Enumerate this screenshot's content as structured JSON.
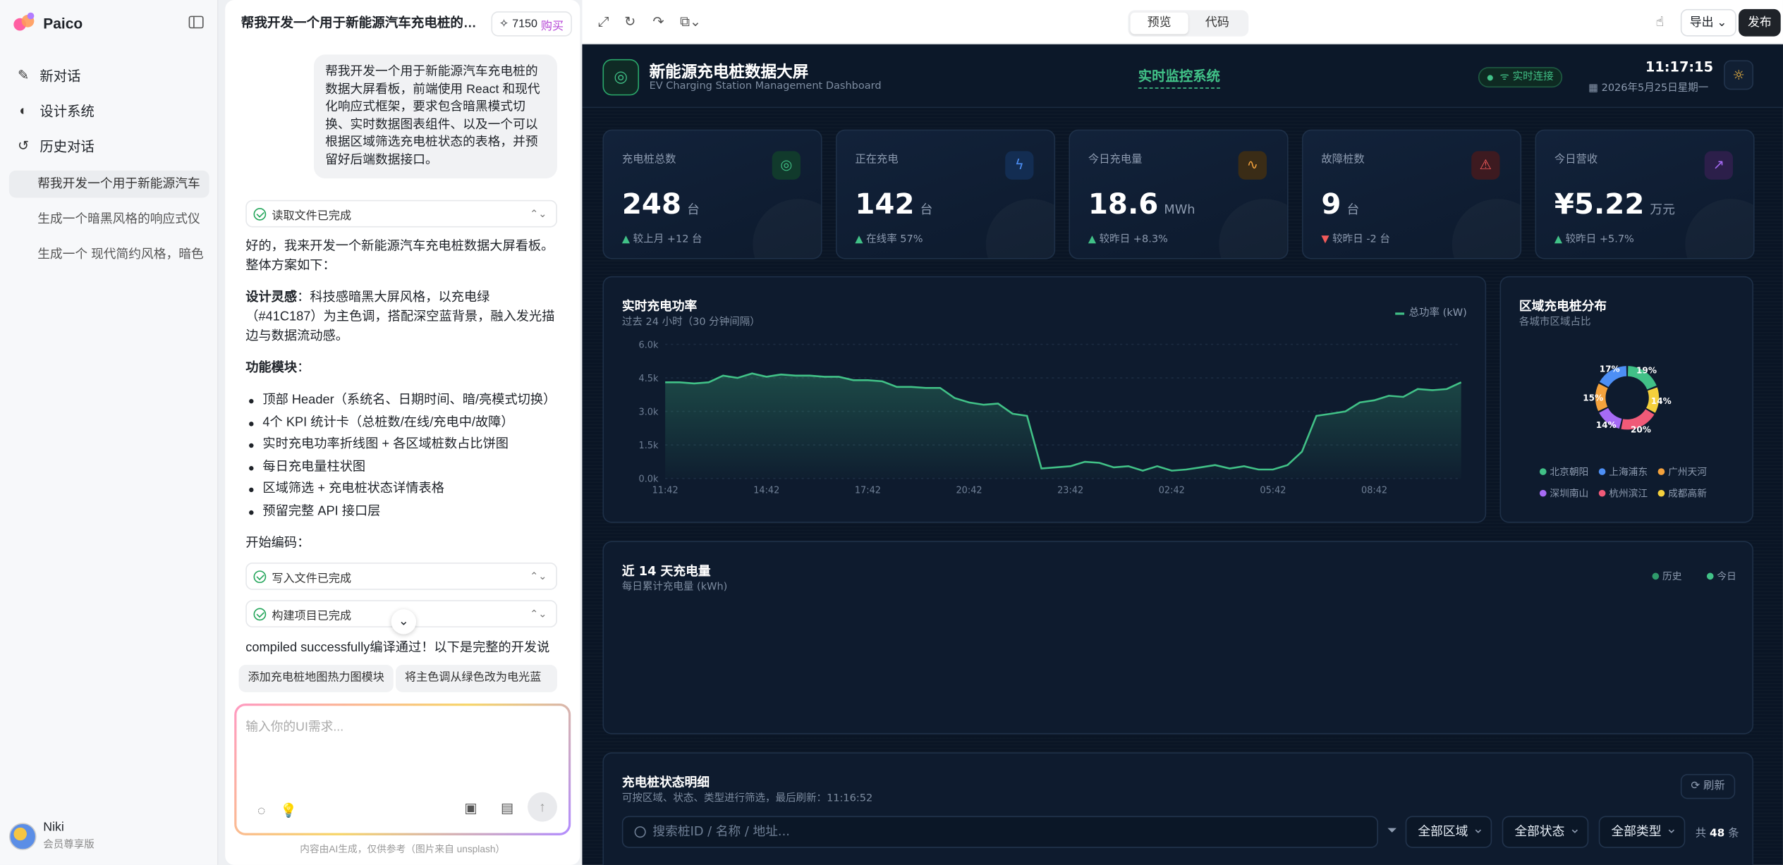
{
  "app": {
    "name": "Paico"
  },
  "sidebar": {
    "nav": [
      {
        "label": "新对话",
        "icon": "edit-icon"
      },
      {
        "label": "设计系统",
        "icon": "palette-icon"
      },
      {
        "label": "历史对话",
        "icon": "history-icon"
      }
    ],
    "history": [
      "帮我开发一个用于新能源汽车",
      "生成一个暗黑风格的响应式仪",
      "生成一个 现代简约风格，暗色"
    ],
    "user": {
      "name": "Niki",
      "role": "会员尊享版"
    }
  },
  "chat": {
    "title": "帮我开发一个用于新能源汽车充电桩的数据...",
    "credits": "7150",
    "buy": "购买",
    "user_message": "帮我开发一个用于新能源汽车充电桩的数据大屏看板，前端使用 React 和现代化响应式框架，要求包含暗黑模式切换、实时数据图表组件、以及一个可以根据区域筛选充电桩状态的表格，并预留好后端数据接口。",
    "status_read": "读取文件已完成",
    "intro": "好的，我来开发一个新能源汽车充电桩数据大屏看板。整体方案如下：",
    "design_label": "设计灵感",
    "design_text": "：科技感暗黑大屏风格，以充电绿（#41C187）为主色调，搭配深空蓝背景，融入发光描边与数据流动感。",
    "modules_label": "功能模块",
    "modules_colon": "：",
    "bullets": [
      "顶部 Header（系统名、日期时间、暗/亮模式切换）",
      "4个 KPI 统计卡（总桩数/在线/充电中/故障）",
      "实时充电功率折线图 + 各区域桩数占比饼图",
      "每日充电量柱状图",
      "区域筛选 + 充电桩状态详情表格",
      "预留完整 API 接口层"
    ],
    "start": "开始编码：",
    "status_write": "写入文件已完成",
    "status_build": "构建项目已完成",
    "compiled": "compiled successfully编译通过！以下是完整的开发说",
    "suggestions": [
      "添加充电桩地图热力图模块",
      "将主色调从绿色改为电光蓝"
    ],
    "input_placeholder": "输入你的UI需求...",
    "footer": "内容由AI生成，仅供参考（图片来自 unsplash）"
  },
  "toolbar": {
    "tab_preview": "预览",
    "tab_code": "代码",
    "export": "导出",
    "publish": "发布"
  },
  "dashboard": {
    "title": "新能源充电桩数据大屏",
    "subtitle": "EV Charging Station Management Dashboard",
    "mid_title": "实时监控系统",
    "live": "实时连接",
    "time": "11:17:15",
    "date": "2026年5月25日星期一",
    "kpis": [
      {
        "label": "充电桩总数",
        "value": "248",
        "unit": "台",
        "arrow": "▲",
        "change": "较上月 +12 台",
        "icon": "target-icon",
        "color": "#41c187",
        "icbg": "#113a2c",
        "arrowColor": "#41c187"
      },
      {
        "label": "正在充电",
        "value": "142",
        "unit": "台",
        "arrow": "▲",
        "change": "在线率 57%",
        "icon": "lightning-icon",
        "color": "#4d8ff5",
        "icbg": "#132d52",
        "arrowColor": "#41c187"
      },
      {
        "label": "今日充电量",
        "value": "18.6",
        "unit": "MWh",
        "arrow": "▲",
        "change": "较昨日 +8.3%",
        "icon": "pulse-icon",
        "color": "#f4a23c",
        "icbg": "#3a2c16",
        "arrowColor": "#41c187"
      },
      {
        "label": "故障桩数",
        "value": "9",
        "unit": "台",
        "arrow": "▼",
        "change": "较昨日 -2 台",
        "icon": "warning-icon",
        "color": "#f05a5a",
        "icbg": "#3d1a20",
        "arrowColor": "#f05a5a"
      },
      {
        "label": "今日营收",
        "value": "¥5.22",
        "unit": "万元",
        "arrow": "▲",
        "change": "较昨日 +5.7%",
        "icon": "trend-up-icon",
        "color": "#a66bf5",
        "icbg": "#2c1f4a",
        "arrowColor": "#41c187"
      }
    ],
    "power": {
      "title": "实时充电功率",
      "subtitle": "过去 24 小时（30 分钟间隔）",
      "legend": "总功率 (kW)"
    },
    "region": {
      "title": "区域充电桩分布",
      "subtitle": "各城市区域占比"
    },
    "daily": {
      "title": "近 14 天充电量",
      "subtitle": "每日累计充电量 (kWh)",
      "legend_hist": "历史",
      "legend_today": "今日"
    },
    "table": {
      "title": "充电桩状态明细",
      "subtitle": "可按区域、状态、类型进行筛选，最后刷新：11:16:52",
      "refresh": "刷新",
      "search_placeholder": "搜索桩ID / 名称 / 地址...",
      "filters": [
        "全部区域",
        "全部状态",
        "全部类型"
      ],
      "count_prefix": "共",
      "count": "48",
      "count_suffix": "条"
    }
  },
  "chart_data": [
    {
      "type": "area",
      "title": "实时充电功率",
      "legend": [
        "总功率 (kW)"
      ],
      "x_ticks": [
        "11:42",
        "14:42",
        "17:42",
        "20:42",
        "23:42",
        "02:42",
        "05:42",
        "08:42"
      ],
      "y_ticks": [
        "0.0k",
        "1.5k",
        "3.0k",
        "4.5k",
        "6.0k"
      ],
      "ylim": [
        0,
        6000
      ],
      "series": [
        {
          "name": "总功率 (kW)",
          "color": "#41c187",
          "values": [
            4300,
            4300,
            4250,
            4300,
            4600,
            4500,
            4700,
            4550,
            4650,
            4600,
            4600,
            4550,
            4550,
            4400,
            4400,
            4350,
            4100,
            4100,
            4050,
            4050,
            3600,
            3400,
            3300,
            3350,
            2900,
            2800,
            450,
            500,
            550,
            750,
            700,
            500,
            550,
            350,
            550,
            350,
            400,
            500,
            600,
            450,
            550,
            400,
            400,
            600,
            1200,
            2800,
            2900,
            3000,
            3400,
            3500,
            3700,
            3650,
            4000,
            3950,
            4000,
            4300
          ]
        }
      ]
    },
    {
      "type": "pie",
      "title": "区域充电桩分布",
      "categories": [
        "北京朝阳",
        "上海浦东",
        "广州天河",
        "深圳南山",
        "杭州滨江",
        "成都高新"
      ],
      "values": [
        19,
        17,
        15,
        14,
        20,
        14
      ],
      "colors": [
        "#41c187",
        "#4d8ff5",
        "#f4a23c",
        "#a66bf5",
        "#f05a78",
        "#f4d03c"
      ]
    },
    {
      "type": "bar",
      "title": "近 14 天充电量",
      "series": [
        {
          "name": "历史",
          "values": []
        },
        {
          "name": "今日",
          "values": []
        }
      ]
    }
  ]
}
